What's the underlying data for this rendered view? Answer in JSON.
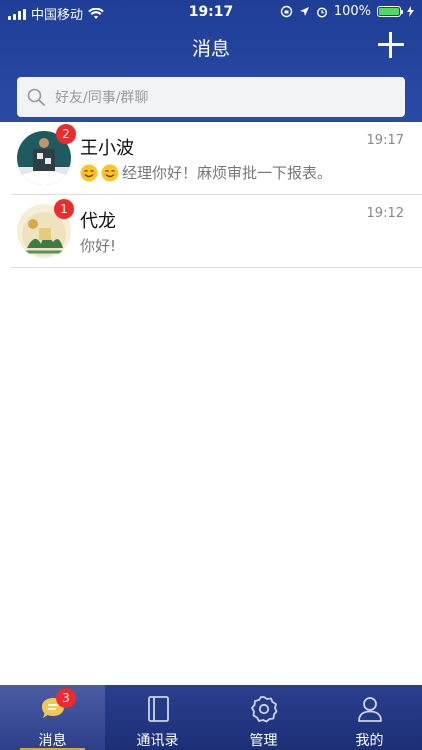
{
  "status_bar": {
    "carrier": "中国移动",
    "time": "19:17",
    "battery": "100%"
  },
  "nav": {
    "title": "消息"
  },
  "search": {
    "placeholder": "好友/同事/群聊"
  },
  "chats": [
    {
      "name": "王小波",
      "time": "19:17",
      "unread": "2",
      "message": "经理你好！麻烦审批一下报表。",
      "emoji_count": 2
    },
    {
      "name": "代龙",
      "time": "19:12",
      "unread": "1",
      "message": "你好!"
    }
  ],
  "tabs": [
    {
      "label": "消息",
      "badge": "3",
      "icon": "chat-icon",
      "active": true
    },
    {
      "label": "通讯录",
      "icon": "contacts-book-icon"
    },
    {
      "label": "管理",
      "icon": "gear-icon"
    },
    {
      "label": "我的",
      "icon": "user-icon"
    }
  ],
  "colors": {
    "header": "#1f3e97",
    "tabbar": "#1c2f76",
    "badge": "#ee2b2b",
    "active_underline": "#d9a34a"
  }
}
